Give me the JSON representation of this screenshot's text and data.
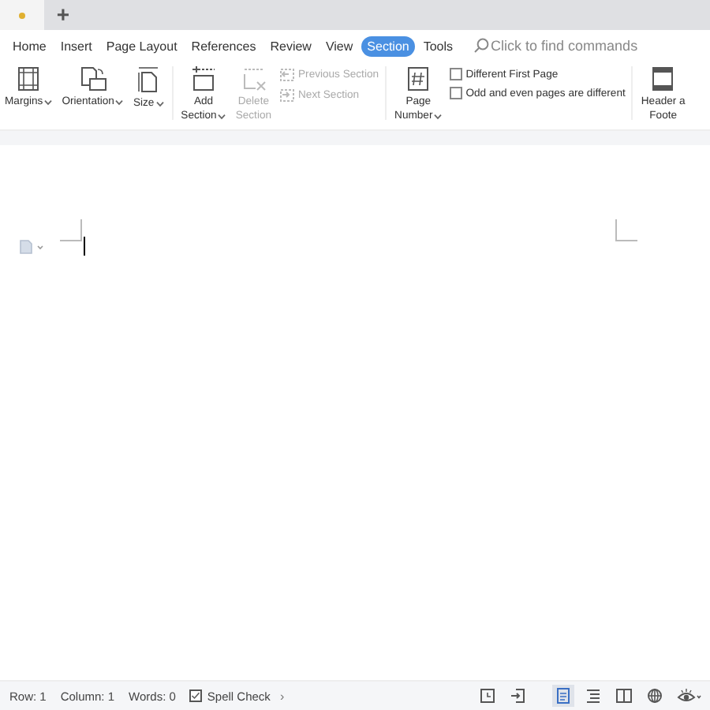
{
  "new_tab": "+",
  "menu": [
    {
      "label": "Home",
      "selected": false
    },
    {
      "label": "Insert",
      "selected": false
    },
    {
      "label": "Page Layout",
      "selected": false
    },
    {
      "label": "References",
      "selected": false
    },
    {
      "label": "Review",
      "selected": false
    },
    {
      "label": "View",
      "selected": false
    },
    {
      "label": "Section",
      "selected": true
    },
    {
      "label": "Tools",
      "selected": false
    }
  ],
  "search": {
    "placeholder": "Click to find commands"
  },
  "ribbon": [
    {
      "kind": "big",
      "lines": [
        "Margins"
      ],
      "dropdown": true,
      "disabled": false
    },
    {
      "kind": "big",
      "lines": [
        "Orientation"
      ],
      "dropdown": true,
      "disabled": false
    },
    {
      "kind": "big",
      "lines": [
        "Size"
      ],
      "dropdown": true,
      "disabled": false
    },
    {
      "kind": "separator"
    },
    {
      "kind": "big",
      "lines": [
        "Add",
        "Section"
      ],
      "dropdown": true,
      "disabled": false
    },
    {
      "kind": "big",
      "lines": [
        "Delete",
        "Section"
      ],
      "dropdown": false,
      "disabled": true
    },
    {
      "kind": "small",
      "items": [
        {
          "label": "Previous Section",
          "disabled": true
        },
        {
          "label": "Next Section",
          "disabled": true
        }
      ]
    },
    {
      "kind": "separator"
    },
    {
      "kind": "big",
      "lines": [
        "Page",
        "Number"
      ],
      "dropdown": true,
      "disabled": false
    },
    {
      "kind": "checks",
      "items": [
        {
          "label": "Different First Page",
          "checked": false
        },
        {
          "label": "Odd and even pages are different",
          "checked": false
        }
      ]
    },
    {
      "kind": "separator"
    },
    {
      "kind": "big",
      "lines": [
        "Header a",
        "Foote"
      ],
      "dropdown": false,
      "disabled": false
    }
  ],
  "status": [
    {
      "label": "Row: 1"
    },
    {
      "label": "Column: 1"
    },
    {
      "label": "Words: 0"
    }
  ],
  "spell_check": {
    "label": "Spell Check",
    "checked": true,
    "more": "›"
  },
  "view_buttons": [
    {
      "selected": false
    },
    {
      "selected": false
    },
    {
      "selected": true
    },
    {
      "selected": false
    },
    {
      "selected": false
    },
    {
      "selected": false
    },
    {
      "selected": false
    }
  ]
}
